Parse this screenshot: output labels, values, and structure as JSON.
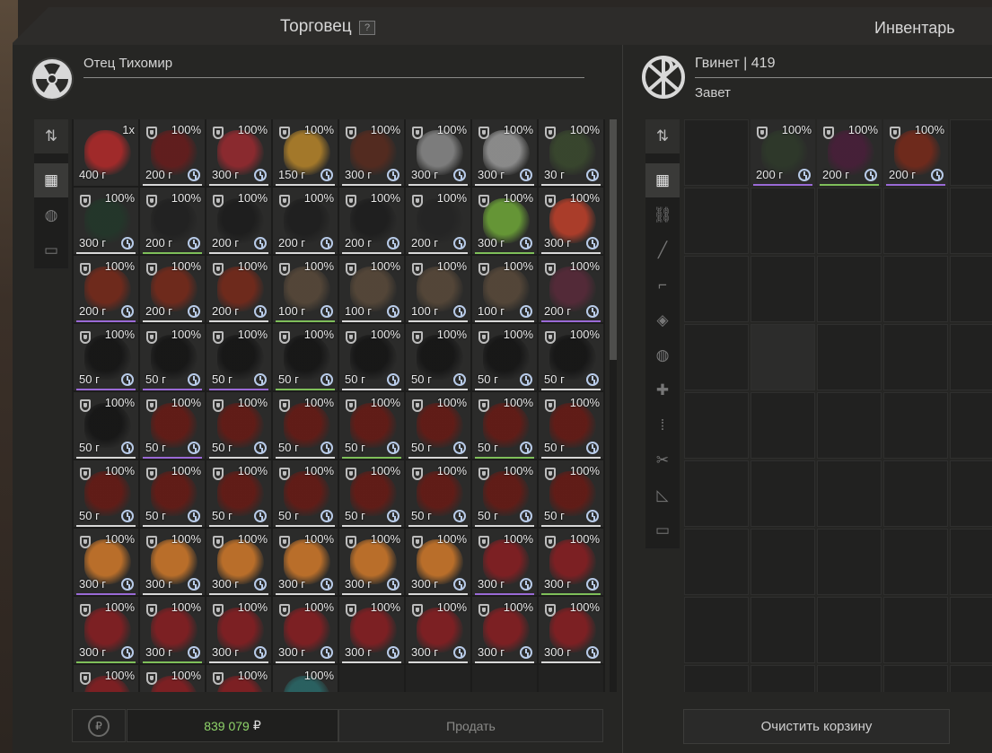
{
  "header": {
    "trader_title": "Торговец",
    "help_label": "?",
    "inventory_title": "Инвентарь"
  },
  "trader": {
    "name": "Отец Тихомир",
    "emblem_icon": "radiation-icon"
  },
  "player": {
    "name": "Гвинет | 419",
    "clan": "Завет",
    "emblem_icon": "chi-rho-icon"
  },
  "trader_tools": [
    {
      "icon": "sort-icon",
      "glyph": "⇅",
      "active": false
    },
    {
      "icon": "grid-view-icon",
      "glyph": "▦",
      "active": true
    },
    {
      "icon": "artifact-icon",
      "glyph": "◍",
      "active": false
    },
    {
      "icon": "box-icon",
      "glyph": "▭",
      "active": false
    }
  ],
  "inventory_tools": [
    {
      "icon": "sort-icon",
      "glyph": "⇅",
      "active": false
    },
    {
      "icon": "grid-view-icon",
      "glyph": "▦",
      "active": true
    },
    {
      "icon": "attachment-icon",
      "glyph": "⛓",
      "active": false
    },
    {
      "icon": "rifle-icon",
      "glyph": "╱",
      "active": false
    },
    {
      "icon": "pistol-icon",
      "glyph": "⌐",
      "active": false
    },
    {
      "icon": "grenade-icon",
      "glyph": "◈",
      "active": false
    },
    {
      "icon": "artifact-icon",
      "glyph": "◍",
      "active": false
    },
    {
      "icon": "medkit-icon",
      "glyph": "✚",
      "active": false
    },
    {
      "icon": "ammo-icon",
      "glyph": "⁞",
      "active": false
    },
    {
      "icon": "tools-icon",
      "glyph": "✂",
      "active": false
    },
    {
      "icon": "blueprint-icon",
      "glyph": "◺",
      "active": false
    },
    {
      "icon": "box-icon",
      "glyph": "▭",
      "active": false
    }
  ],
  "colors": {
    "rarity_green": "#7fbf5a",
    "rarity_purple": "#9a6ad6",
    "rarity_white": "#d8d8d8",
    "balance_green": "#8fd46a",
    "clock_blue": "#b8cbe8"
  },
  "trader_items": [
    {
      "qty": "1x",
      "price": "400 г",
      "art": "#b52a2a",
      "rarity": "none"
    },
    {
      "pct": "100%",
      "price": "200 г",
      "art": "#6a1c1c",
      "rarity": "white"
    },
    {
      "pct": "100%",
      "price": "300 г",
      "art": "#9b2a30",
      "rarity": "white"
    },
    {
      "pct": "100%",
      "price": "150 г",
      "art": "#b8862a",
      "rarity": "white"
    },
    {
      "pct": "100%",
      "price": "300 г",
      "art": "#5a2b1e",
      "rarity": "white"
    },
    {
      "pct": "100%",
      "price": "300 г",
      "art": "#8a8a8a",
      "rarity": "white"
    },
    {
      "pct": "100%",
      "price": "300 г",
      "art": "#9a9a9a",
      "rarity": "white"
    },
    {
      "pct": "100%",
      "price": "30 г",
      "art": "#3a4a2e",
      "rarity": "white"
    },
    {
      "pct": "100%",
      "price": "300 г",
      "art": "#22382a",
      "rarity": "white"
    },
    {
      "pct": "100%",
      "price": "200 г",
      "art": "#202020",
      "rarity": "green"
    },
    {
      "pct": "100%",
      "price": "200 г",
      "art": "#1c1c1c",
      "rarity": "white"
    },
    {
      "pct": "100%",
      "price": "200 г",
      "art": "#1e1e1e",
      "rarity": "white"
    },
    {
      "pct": "100%",
      "price": "200 г",
      "art": "#1d1d1d",
      "rarity": "white"
    },
    {
      "pct": "100%",
      "price": "200 г",
      "art": "#242424",
      "rarity": "white"
    },
    {
      "pct": "100%",
      "price": "300 г",
      "art": "#6fa838",
      "rarity": "green"
    },
    {
      "pct": "100%",
      "price": "300 г",
      "art": "#c0402a",
      "rarity": "white"
    },
    {
      "pct": "100%",
      "price": "200 г",
      "art": "#7a2a1a",
      "rarity": "purple"
    },
    {
      "pct": "100%",
      "price": "200 г",
      "art": "#7a2a1a",
      "rarity": "white"
    },
    {
      "pct": "100%",
      "price": "200 г",
      "art": "#7a2a1a",
      "rarity": "white"
    },
    {
      "pct": "100%",
      "price": "100 г",
      "art": "#5a4a3a",
      "rarity": "green"
    },
    {
      "pct": "100%",
      "price": "100 г",
      "art": "#5a4a3a",
      "rarity": "white"
    },
    {
      "pct": "100%",
      "price": "100 г",
      "art": "#5a4a3a",
      "rarity": "white"
    },
    {
      "pct": "100%",
      "price": "100 г",
      "art": "#5a4a3a",
      "rarity": "white"
    },
    {
      "pct": "100%",
      "price": "200 г",
      "art": "#5a2a3a",
      "rarity": "purple"
    },
    {
      "pct": "100%",
      "price": "50 г",
      "art": "#141414",
      "rarity": "purple"
    },
    {
      "pct": "100%",
      "price": "50 г",
      "art": "#141414",
      "rarity": "purple"
    },
    {
      "pct": "100%",
      "price": "50 г",
      "art": "#141414",
      "rarity": "purple"
    },
    {
      "pct": "100%",
      "price": "50 г",
      "art": "#141414",
      "rarity": "green"
    },
    {
      "pct": "100%",
      "price": "50 г",
      "art": "#141414",
      "rarity": "white"
    },
    {
      "pct": "100%",
      "price": "50 г",
      "art": "#141414",
      "rarity": "white"
    },
    {
      "pct": "100%",
      "price": "50 г",
      "art": "#141414",
      "rarity": "white"
    },
    {
      "pct": "100%",
      "price": "50 г",
      "art": "#141414",
      "rarity": "white"
    },
    {
      "pct": "100%",
      "price": "50 г",
      "art": "#141414",
      "rarity": "white"
    },
    {
      "pct": "100%",
      "price": "50 г",
      "art": "#6a1a14",
      "rarity": "purple"
    },
    {
      "pct": "100%",
      "price": "50 г",
      "art": "#6a1a14",
      "rarity": "white"
    },
    {
      "pct": "100%",
      "price": "50 г",
      "art": "#6a1a14",
      "rarity": "white"
    },
    {
      "pct": "100%",
      "price": "50 г",
      "art": "#6a1a14",
      "rarity": "green"
    },
    {
      "pct": "100%",
      "price": "50 г",
      "art": "#6a1a14",
      "rarity": "white"
    },
    {
      "pct": "100%",
      "price": "50 г",
      "art": "#6a1a14",
      "rarity": "green"
    },
    {
      "pct": "100%",
      "price": "50 г",
      "art": "#6a1a14",
      "rarity": "white"
    },
    {
      "pct": "100%",
      "price": "50 г",
      "art": "#6a1a14",
      "rarity": "white"
    },
    {
      "pct": "100%",
      "price": "50 г",
      "art": "#6a1a14",
      "rarity": "white"
    },
    {
      "pct": "100%",
      "price": "50 г",
      "art": "#6a1a14",
      "rarity": "white"
    },
    {
      "pct": "100%",
      "price": "50 г",
      "art": "#6a1a14",
      "rarity": "white"
    },
    {
      "pct": "100%",
      "price": "50 г",
      "art": "#6a1a14",
      "rarity": "white"
    },
    {
      "pct": "100%",
      "price": "50 г",
      "art": "#6a1a14",
      "rarity": "white"
    },
    {
      "pct": "100%",
      "price": "50 г",
      "art": "#6a1a14",
      "rarity": "white"
    },
    {
      "pct": "100%",
      "price": "50 г",
      "art": "#6a1a14",
      "rarity": "white"
    },
    {
      "pct": "100%",
      "price": "300 г",
      "art": "#d27a2a",
      "rarity": "purple"
    },
    {
      "pct": "100%",
      "price": "300 г",
      "art": "#d27a2a",
      "rarity": "white"
    },
    {
      "pct": "100%",
      "price": "300 г",
      "art": "#d27a2a",
      "rarity": "white"
    },
    {
      "pct": "100%",
      "price": "300 г",
      "art": "#d27a2a",
      "rarity": "white"
    },
    {
      "pct": "100%",
      "price": "300 г",
      "art": "#d27a2a",
      "rarity": "white"
    },
    {
      "pct": "100%",
      "price": "300 г",
      "art": "#d27a2a",
      "rarity": "white"
    },
    {
      "pct": "100%",
      "price": "300 г",
      "art": "#8a1e22",
      "rarity": "purple"
    },
    {
      "pct": "100%",
      "price": "300 г",
      "art": "#8a1e22",
      "rarity": "green"
    },
    {
      "pct": "100%",
      "price": "300 г",
      "art": "#8a1e22",
      "rarity": "green"
    },
    {
      "pct": "100%",
      "price": "300 г",
      "art": "#8a1e22",
      "rarity": "green"
    },
    {
      "pct": "100%",
      "price": "300 г",
      "art": "#8a1e22",
      "rarity": "white"
    },
    {
      "pct": "100%",
      "price": "300 г",
      "art": "#8a1e22",
      "rarity": "white"
    },
    {
      "pct": "100%",
      "price": "300 г",
      "art": "#8a1e22",
      "rarity": "white"
    },
    {
      "pct": "100%",
      "price": "300 г",
      "art": "#8a1e22",
      "rarity": "white"
    },
    {
      "pct": "100%",
      "price": "300 г",
      "art": "#8a1e22",
      "rarity": "white"
    },
    {
      "pct": "100%",
      "price": "300 г",
      "art": "#8a1e22",
      "rarity": "white"
    },
    {
      "pct": "100%",
      "price": "",
      "art": "#8a1e22",
      "rarity": "none"
    },
    {
      "pct": "100%",
      "price": "",
      "art": "#8a1e22",
      "rarity": "none"
    },
    {
      "pct": "100%",
      "price": "",
      "art": "#8a1e22",
      "rarity": "none"
    },
    {
      "pct": "100%",
      "price": "",
      "art": "#2a6a6a",
      "rarity": "none",
      "noshield": true
    }
  ],
  "inventory_items": [
    {
      "pct": "100%",
      "price": "200 г",
      "art": "#2e3a2a",
      "rarity": "purple"
    },
    {
      "pct": "100%",
      "price": "200 г",
      "art": "#4a1e3a",
      "rarity": "green"
    },
    {
      "pct": "100%",
      "price": "200 г",
      "art": "#7a2a1a",
      "rarity": "purple"
    }
  ],
  "footer": {
    "balance": "839 079",
    "currency": "₽",
    "refresh_glyph": "₽",
    "sell_label": "Продать",
    "clear_cart_label": "Очистить корзину"
  },
  "scroll": {
    "trader_position": 0.0,
    "trader_visible": 0.42
  }
}
